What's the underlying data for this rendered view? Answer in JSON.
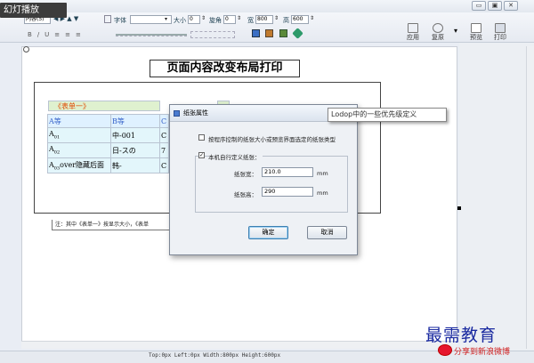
{
  "window": {
    "overlay_tag": "幻灯播放",
    "controls": {
      "minimize": "▭",
      "restore": "▣",
      "close": "✕"
    },
    "help": "?"
  },
  "toolbar": {
    "title_field": "内容(5)",
    "font_label": "字体",
    "size_label": "大小",
    "size_value": "0",
    "rotation_label": "旋角",
    "rotation_value": "0",
    "width_label": "宽",
    "width_value": "800",
    "height_label": "高",
    "height_value": "600",
    "format_buttons": [
      "B",
      "/",
      "U",
      "≡",
      "≡",
      "≡"
    ],
    "apply_label": "应用",
    "undo_label": "复原",
    "preview_label": "预览",
    "print_label": "打印"
  },
  "document": {
    "title": "页面内容改变布局打印",
    "table_label": "《表单一》",
    "table_header": [
      "A等",
      "B等",
      "C"
    ],
    "rows": [
      {
        "a_main": "A",
        "a_sub": "01",
        "a_tail": "",
        "b": "中-001",
        "c": "C"
      },
      {
        "a_main": "A",
        "a_sub": "02",
        "a_tail": "",
        "b": "日-スの",
        "c": "7"
      },
      {
        "a_main": "A",
        "a_sub": "03",
        "a_tail": "over隐藏后面",
        "b": "韩-",
        "c": "C"
      }
    ],
    "note": "注：其中《表单一》按显示大小，《表单"
  },
  "tooltip": "Lodop中的一些优先级定义",
  "dialog": {
    "title": "纸张属性",
    "option1": "按程序控制的纸张大小或预览界面选定的纸张类型",
    "option2": "本机自行定义纸张：",
    "option2_checked": "✓",
    "width_label": "纸张宽：",
    "width_value": "210.0",
    "height_label": "纸张高：",
    "height_value": "290",
    "unit": "mm",
    "ok_label": "确定",
    "cancel_label": "取消"
  },
  "statusbar": "Top:0px   Left:0px   Width:800px   Height:600px",
  "watermark": {
    "brand": "最需教育",
    "share": "分享到新浪微博"
  }
}
